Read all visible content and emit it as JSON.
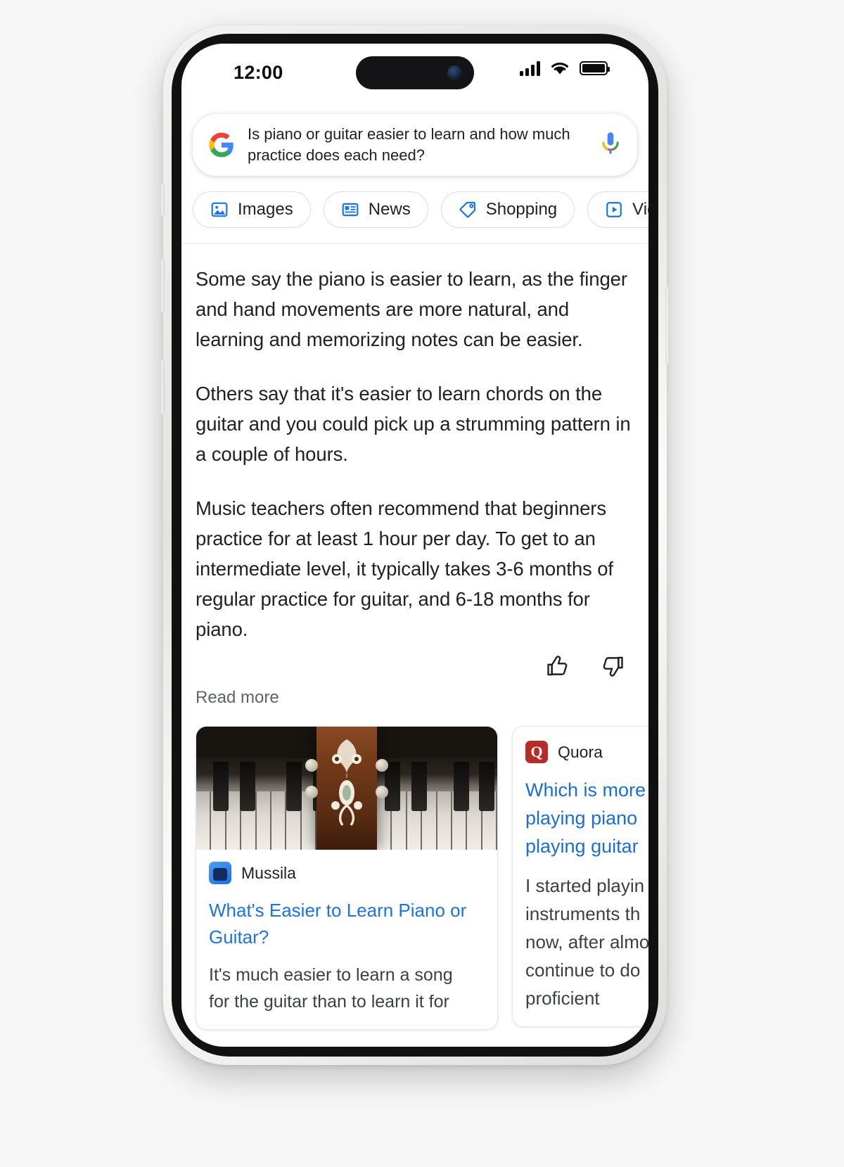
{
  "status_bar": {
    "time": "12:00",
    "signal_icon": "cellular-signal-icon",
    "wifi_icon": "wifi-icon",
    "battery_icon": "battery-icon"
  },
  "search": {
    "logo_icon": "google-logo-icon",
    "query": "Is piano or guitar easier to learn and how much practice does each need?",
    "mic_icon": "microphone-icon"
  },
  "filters": [
    {
      "label": "Images",
      "icon": "image-icon"
    },
    {
      "label": "News",
      "icon": "newspaper-icon"
    },
    {
      "label": "Shopping",
      "icon": "price-tag-icon"
    },
    {
      "label": "Videos",
      "icon": "video-play-icon"
    }
  ],
  "answer": {
    "paragraphs": [
      "Some say the piano is easier to learn, as the finger and hand movements are more natural, and learning and memorizing notes can be easier.",
      "Others say that it's easier to learn chords on the guitar and you could pick up a strumming pattern in a couple of hours.",
      "Music teachers often recommend that beginners practice for at least 1 hour per day. To get to an intermediate level, it typically takes 3-6 months of regular practice for guitar, and 6-18 months for piano."
    ],
    "thumbs_up_icon": "thumbs-up-icon",
    "thumbs_down_icon": "thumbs-down-icon",
    "read_more_label": "Read more"
  },
  "cards": [
    {
      "source": "Mussila",
      "favicon_icon": "mussila-favicon-icon",
      "title": "What's Easier to Learn Piano or Guitar?",
      "snippet_lines": [
        "It's much easier to learn a song",
        "for the guitar than to learn it for"
      ],
      "image_alt": "piano-keys-with-guitar-headstock-image"
    },
    {
      "source": "Quora",
      "favicon_icon": "quora-favicon-icon",
      "favicon_letter": "Q",
      "title_lines": [
        "Which is more",
        "playing piano",
        "playing guitar"
      ],
      "snippet_lines": [
        "I started playin",
        "instruments th",
        "now, after almo",
        "continue to do",
        "proficient"
      ]
    }
  ],
  "colors": {
    "link_blue": "#1a73e8",
    "text_primary": "#202124",
    "text_secondary": "#5f6368",
    "chip_border": "#dadce0",
    "quora_red": "#b92b27",
    "google_blue": "#4285F4",
    "google_red": "#EA4335",
    "google_yellow": "#FBBC05",
    "google_green": "#34A853"
  }
}
